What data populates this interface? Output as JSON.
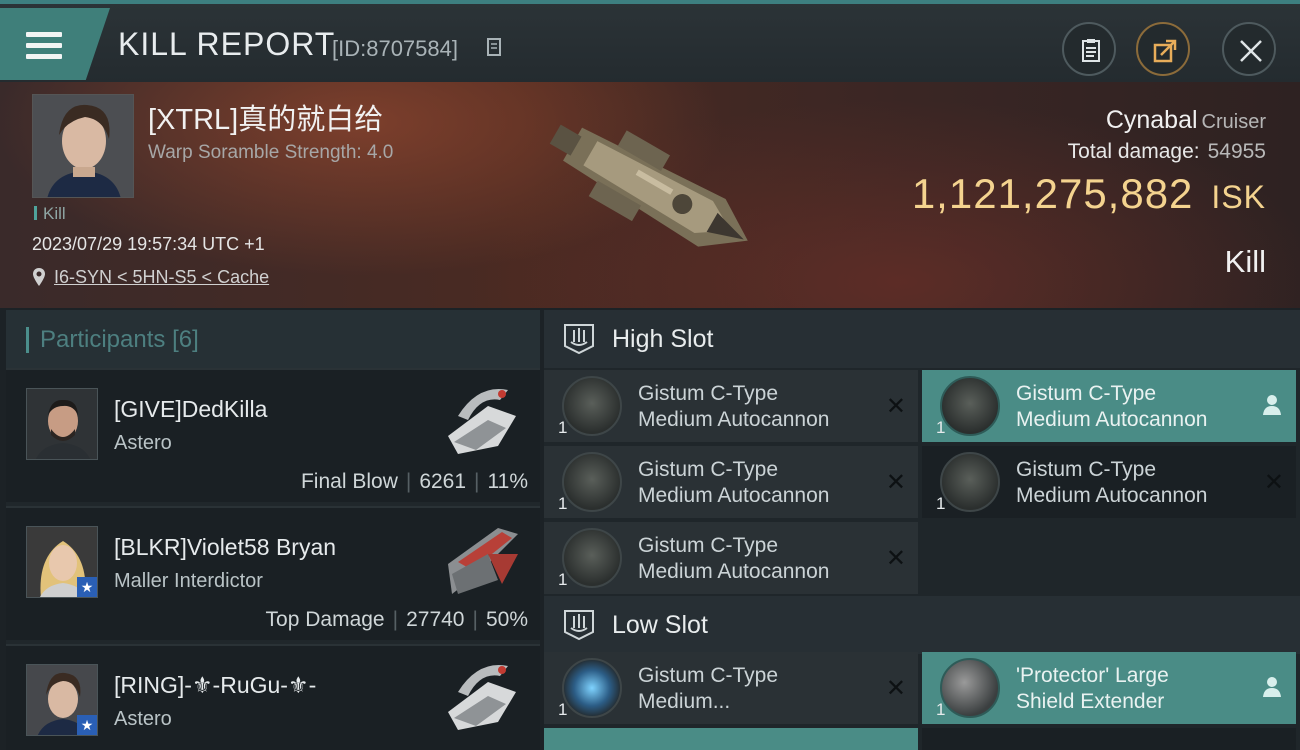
{
  "header": {
    "title": "KILL REPORT",
    "report_id": "[ID:8707584]",
    "icons": [
      "menu-icon",
      "copy-icon",
      "clipboard-icon",
      "share-icon",
      "close-icon"
    ]
  },
  "victim": {
    "name": "[XTRL]真的就白给",
    "scramble": "Warp Soramble Strength: 4.0",
    "tag": "Kill",
    "datetime": "2023/07/29 19:57:34 UTC +1",
    "location": "I6-SYN < 5HN-S5 < Cache",
    "ship_name": "Cynabal",
    "ship_class": "Cruiser",
    "total_damage_label": "Total damage:",
    "total_damage": "54955",
    "isk_value": "1,121,275,882",
    "isk_unit": "ISK",
    "result": "Kill"
  },
  "participants": {
    "title": "Participants",
    "count": "[6]",
    "items": [
      {
        "name": "[GIVE]DedKilla",
        "ship": "Astero",
        "role": "Final Blow",
        "damage": "6261",
        "percent": "11%",
        "starred": false
      },
      {
        "name": "[BLKR]Violet58 Bryan",
        "ship": "Maller Interdictor",
        "role": "Top Damage",
        "damage": "27740",
        "percent": "50%",
        "starred": true
      },
      {
        "name": "[RING]-⚜-RuGu-⚜-",
        "ship": "Astero",
        "role": "",
        "damage": "",
        "percent": "",
        "starred": true
      }
    ]
  },
  "slots": {
    "high": {
      "title": "High Slot",
      "modules": [
        {
          "line1": "Gistum C-Type",
          "line2": "Medium Autocannon",
          "qty": "1",
          "state": "destroyed"
        },
        {
          "line1": "Gistum C-Type",
          "line2": "Medium Autocannon",
          "qty": "1",
          "state": "dropped"
        },
        {
          "line1": "Gistum C-Type",
          "line2": "Medium Autocannon",
          "qty": "1",
          "state": "destroyed"
        },
        {
          "line1": "Gistum C-Type",
          "line2": "Medium Autocannon",
          "qty": "1",
          "state": "destroyed"
        },
        {
          "line1": "Gistum C-Type",
          "line2": "Medium Autocannon",
          "qty": "1",
          "state": "destroyed"
        }
      ]
    },
    "low": {
      "title": "Low Slot",
      "modules": [
        {
          "line1": "Gistum C-Type",
          "line2": "Medium...",
          "qty": "1",
          "state": "destroyed"
        },
        {
          "line1": "'Protector' Large",
          "line2": "Shield Extender",
          "qty": "1",
          "state": "dropped"
        }
      ]
    }
  }
}
